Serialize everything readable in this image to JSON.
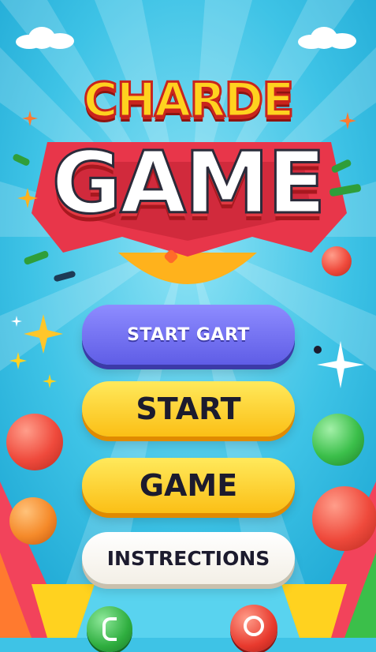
{
  "title": {
    "line1": "CHARDE",
    "line2": "GAME"
  },
  "buttons": {
    "primary_label": "START GART",
    "start_label": "START",
    "game_label": "GAME",
    "instructions_label": "INSTRECTIONS"
  },
  "colors": {
    "sky": "#3ec3e6",
    "title_yellow": "#ffd21f",
    "title_red": "#e23a43",
    "button_purple": "#6f6df0",
    "button_yellow": "#fdd02a",
    "ball_red": "#ef4a3c",
    "ball_green": "#3bbf4a",
    "ball_orange": "#f58a2a"
  },
  "icons": {
    "bottom_left": "green-round-icon",
    "bottom_right": "red-round-icon"
  }
}
